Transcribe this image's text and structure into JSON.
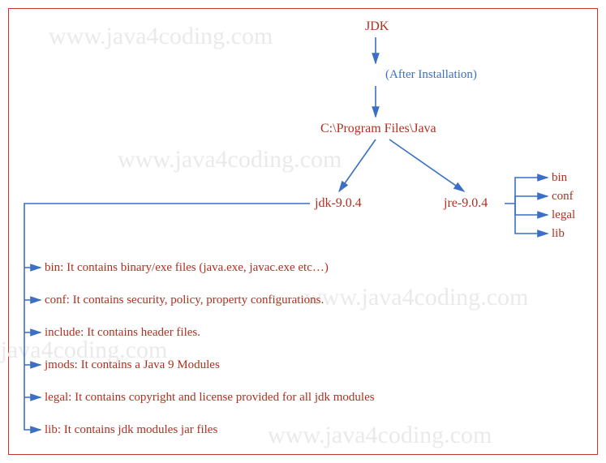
{
  "watermark": "www.java4coding.com",
  "root": "JDK",
  "after_install": "(After Installation)",
  "path": "C:\\Program Files\\Java",
  "jdk_dir": "jdk-9.0.4",
  "jre_dir": "jre-9.0.4",
  "jre_children": {
    "0": "bin",
    "1": "conf",
    "2": "legal",
    "3": "lib"
  },
  "jdk_children": {
    "0": "bin: It contains binary/exe files (java.exe, javac.exe etc…)",
    "1": "conf: It contains security, policy, property configurations.",
    "2": "include: It contains header files.",
    "3": "jmods: It contains a Java 9 Modules",
    "4": "legal: It contains copyright and license provided for all jdk modules",
    "5": "lib: It contains jdk modules jar files"
  }
}
